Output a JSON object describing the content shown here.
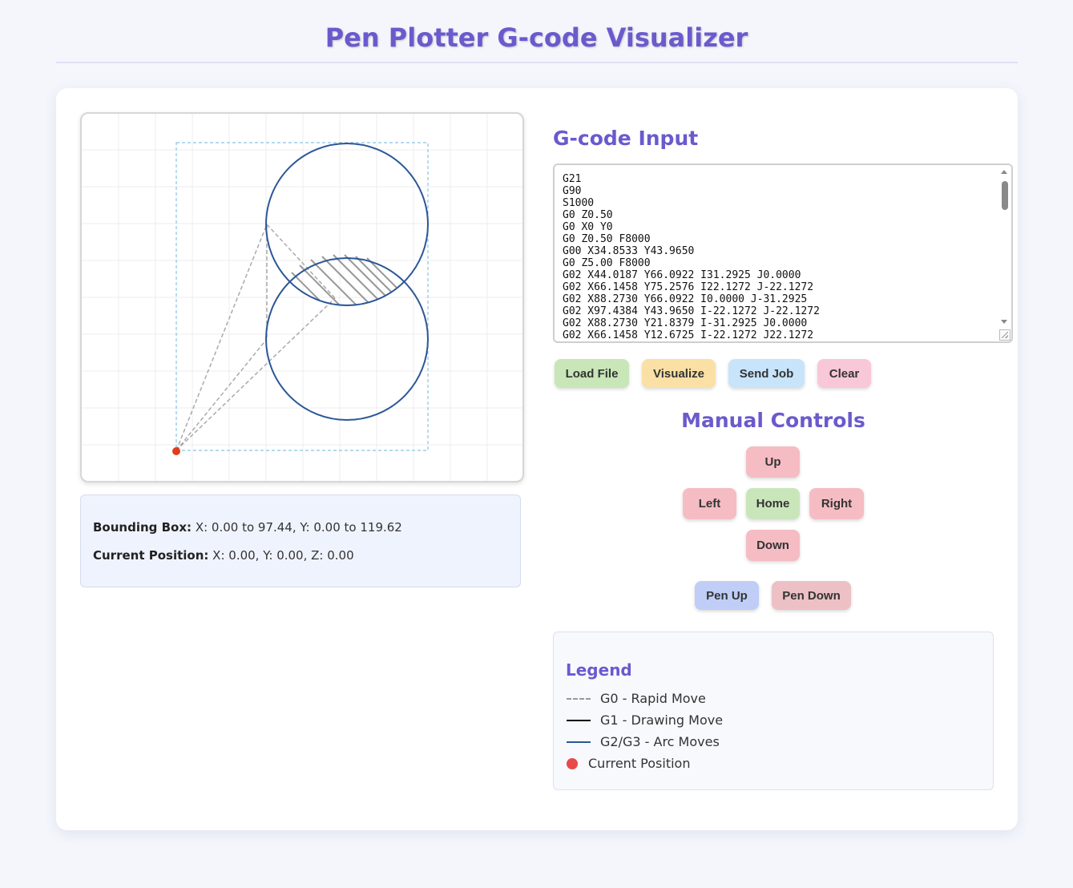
{
  "header": {
    "title": "Pen Plotter G-code Visualizer"
  },
  "info": {
    "bounding_label": "Bounding Box:",
    "bounding_value": "X: 0.00 to 97.44, Y: 0.00 to 119.62",
    "position_label": "Current Position:",
    "position_value": "X: 0.00, Y: 0.00, Z: 0.00"
  },
  "gcode": {
    "title": "G-code Input",
    "text": "G21\nG90\nS1000\nG0 Z0.50\nG0 X0 Y0\nG0 Z0.50 F8000\nG00 X34.8533 Y43.9650\nG0 Z5.00 F8000\nG02 X44.0187 Y66.0922 I31.2925 J0.0000\nG02 X66.1458 Y75.2576 I22.1272 J-22.1272\nG02 X88.2730 Y66.0922 I0.0000 J-31.2925\nG02 X97.4384 Y43.9650 I-22.1272 J-22.1272\nG02 X88.2730 Y21.8379 I-31.2925 J0.0000\nG02 X66.1458 Y12.6725 I-22.1272 J22.1272"
  },
  "buttons": {
    "load": "Load File",
    "visualize": "Visualize",
    "send": "Send Job",
    "clear": "Clear"
  },
  "manual": {
    "title": "Manual Controls",
    "up": "Up",
    "left": "Left",
    "home": "Home",
    "right": "Right",
    "down": "Down",
    "pen_up": "Pen Up",
    "pen_down": "Pen Down"
  },
  "legend": {
    "title": "Legend",
    "items": [
      {
        "label": "G0 - Rapid Move",
        "color": "#999999",
        "style": "dashed"
      },
      {
        "label": "G1 - Drawing Move",
        "color": "#000000",
        "style": "solid"
      },
      {
        "label": "G2/G3 - Arc Moves",
        "color": "#2b5797",
        "style": "solid"
      },
      {
        "label": "Current Position",
        "color": "#e84a4a",
        "style": "dot"
      }
    ]
  },
  "colors": {
    "accent": "#6a5acd",
    "arc": "#2b5797",
    "rapid": "#999999",
    "bbox": "#88c4e4",
    "current": "#e33b1e",
    "btn_load": "#c8e6b8",
    "btn_visualize": "#fbe0a6",
    "btn_send": "#c7e4fb",
    "btn_clear": "#f8c8d8",
    "btn_jog": "#f5bcc4",
    "btn_home": "#c9e6bb",
    "btn_pen_up": "#bfcdf7",
    "btn_pen_down": "#ecc0c4"
  }
}
